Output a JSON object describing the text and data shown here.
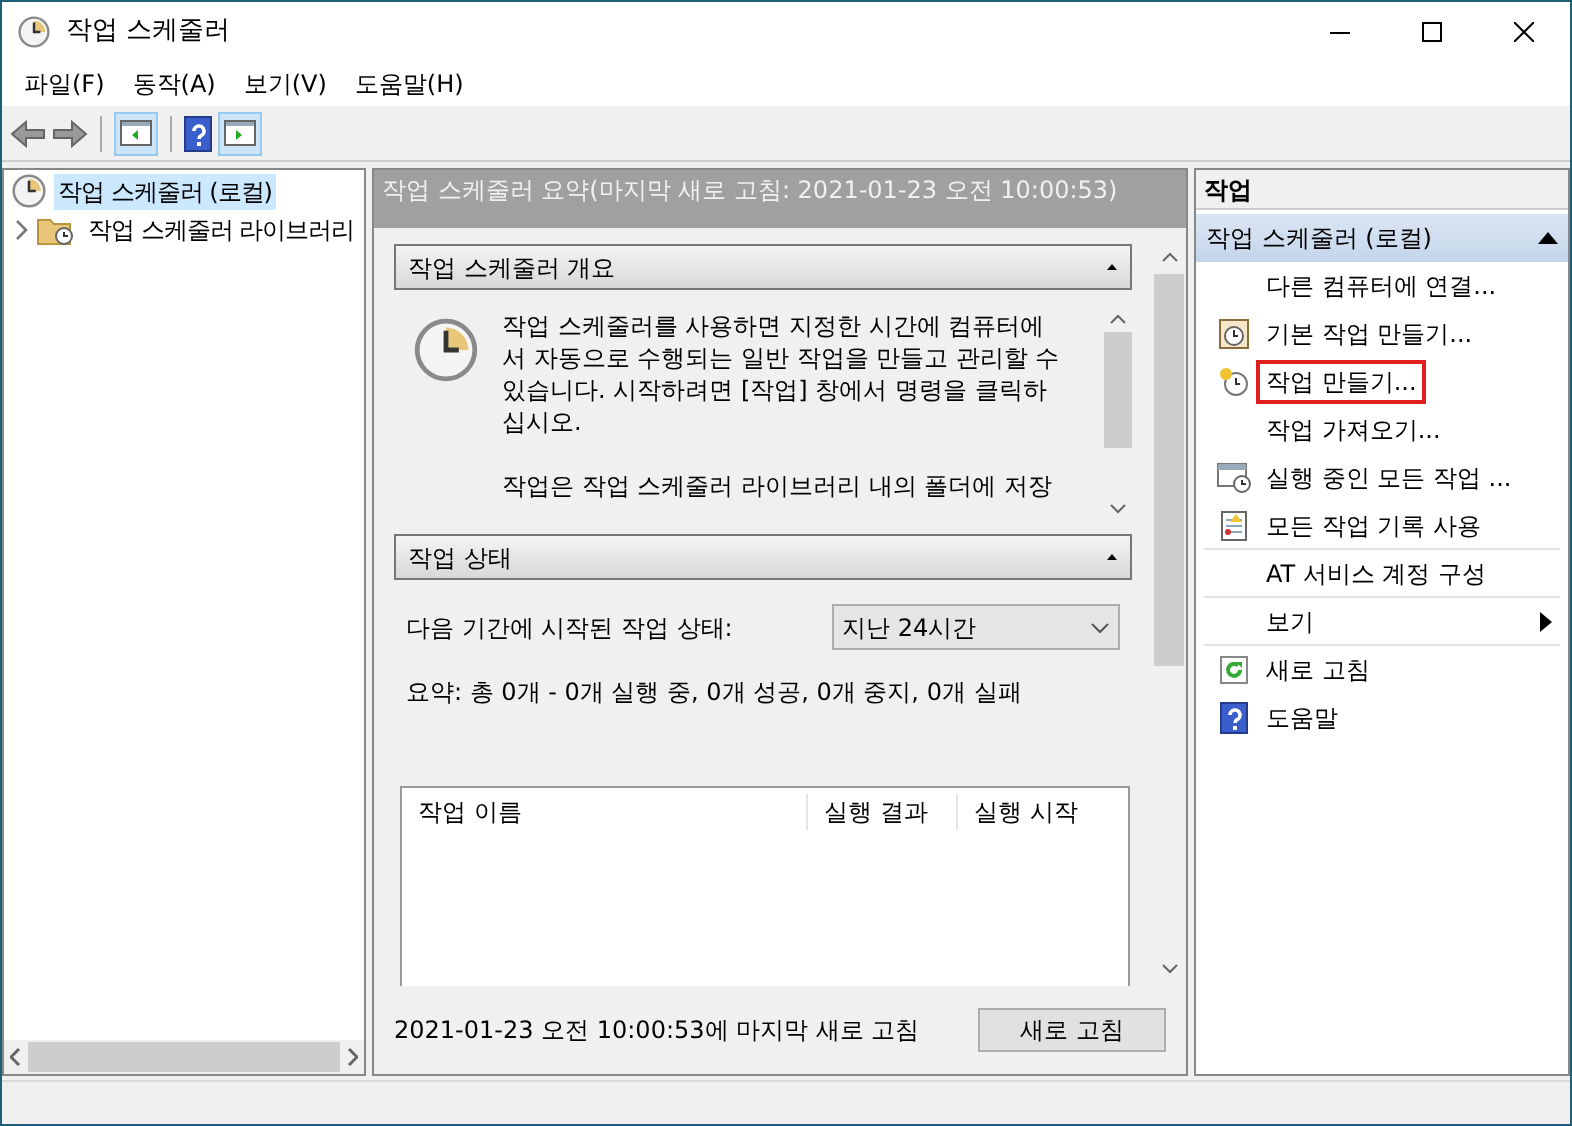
{
  "window": {
    "title": "작업 스케줄러"
  },
  "menu": [
    "파일(F)",
    "동작(A)",
    "보기(V)",
    "도움말(H)"
  ],
  "tree": [
    {
      "label": "작업 스케줄러 (로컬)",
      "selected": true,
      "children": [
        {
          "label": "작업 스케줄러 라이브러리",
          "selected": false,
          "expanded": false
        }
      ]
    }
  ],
  "summary": {
    "header": "작업 스케줄러 요약(마지막 새로 고침: 2021-01-23 오전 10:00:53)",
    "overview": {
      "title": "작업 스케줄러 개요",
      "paragraphs": [
        "작업 스케줄러를 사용하면 지정한 시간에 컴퓨터에서 자동으로 수행되는 일반 작업을 만들고 관리할 수 있습니다. 시작하려면 [작업] 창에서 명령을 클릭하십시오.",
        "작업은 작업 스케줄러 라이브러리 내의 폴더에 저장"
      ]
    },
    "status": {
      "title": "작업 상태",
      "period_label": "다음 기간에 시작된 작업 상태:",
      "period_value": "지난 24시간",
      "summary_text": "요약: 총 0개 - 0개 실행 중, 0개 성공, 0개 중지, 0개 실패",
      "columns": [
        "작업 이름",
        "실행 결과",
        "실행 시작"
      ]
    },
    "footer_text": "2021-01-23 오전 10:00:53에 마지막 새로 고침",
    "refresh_button": "새로 고침"
  },
  "actions": {
    "title": "작업",
    "group": "작업 스케줄러 (로컬)",
    "items": [
      {
        "label": "다른 컴퓨터에 연결...",
        "kind": "none",
        "submenu": false,
        "highlighted": false,
        "divider_after": false
      },
      {
        "label": "기본 작업 만들기...",
        "kind": "basic",
        "submenu": false,
        "highlighted": false,
        "divider_after": false
      },
      {
        "label": "작업 만들기...",
        "kind": "create",
        "submenu": false,
        "highlighted": true,
        "divider_after": false
      },
      {
        "label": "작업 가져오기...",
        "kind": "none",
        "submenu": false,
        "highlighted": false,
        "divider_after": false
      },
      {
        "label": "실행 중인 모든 작업 ...",
        "kind": "running",
        "submenu": false,
        "highlighted": false,
        "divider_after": false
      },
      {
        "label": "모든 작업 기록 사용",
        "kind": "history",
        "submenu": false,
        "highlighted": false,
        "divider_after": true
      },
      {
        "label": "AT 서비스 계정 구성",
        "kind": "none",
        "submenu": false,
        "highlighted": false,
        "divider_after": true
      },
      {
        "label": "보기",
        "kind": "none",
        "submenu": true,
        "highlighted": false,
        "divider_after": true
      },
      {
        "label": "새로 고침",
        "kind": "refresh",
        "submenu": false,
        "highlighted": false,
        "divider_after": false
      },
      {
        "label": "도움말",
        "kind": "help",
        "submenu": false,
        "highlighted": false,
        "divider_after": false
      }
    ]
  }
}
